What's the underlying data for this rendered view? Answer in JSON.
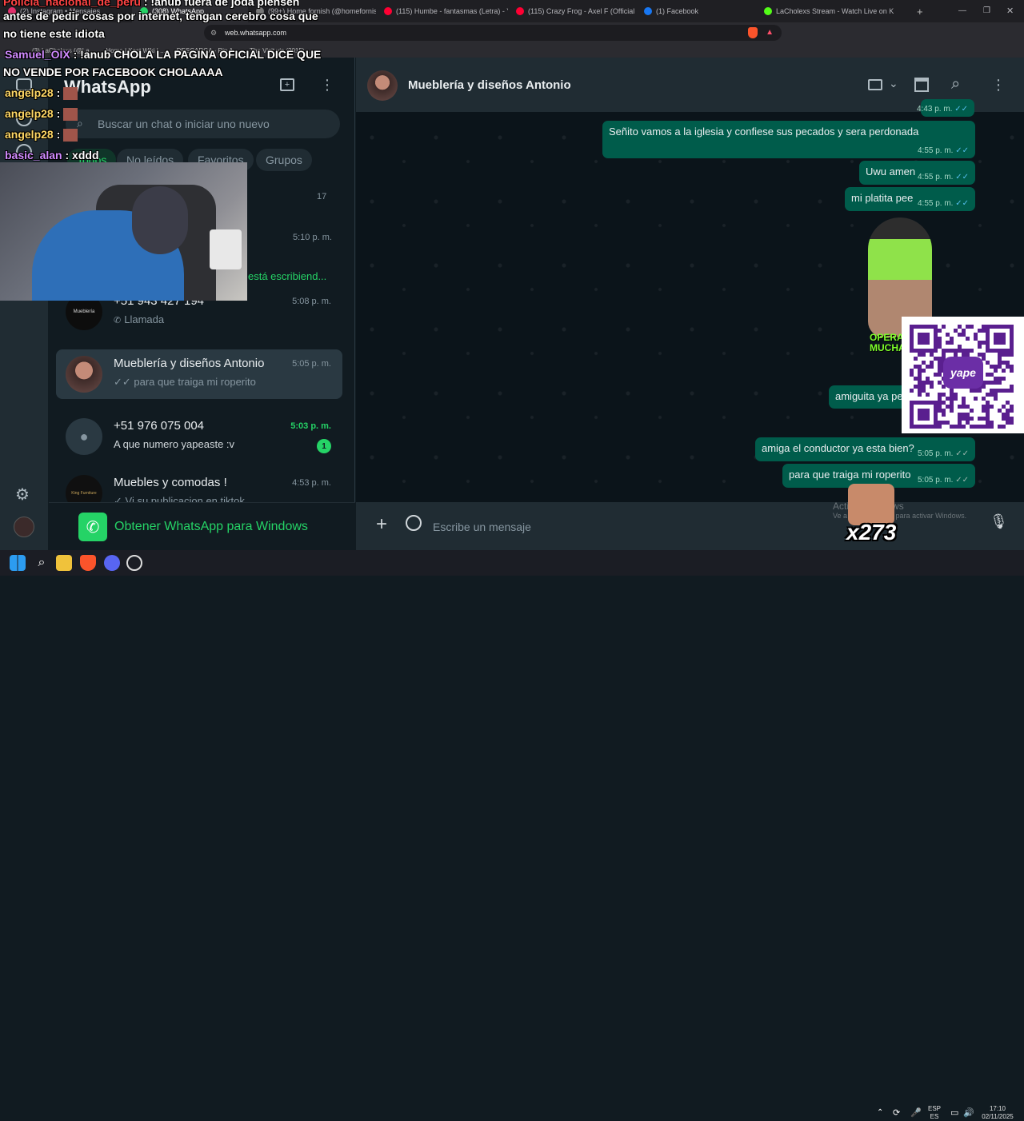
{
  "browser": {
    "tabs": [
      {
        "label": "(2) Instagram • Mensajes",
        "color": "#e1306c"
      },
      {
        "label": "(308) WhatsApp",
        "color": "#25d366"
      },
      {
        "label": "(99+) Home fornish (@homefornish)",
        "color": "#777"
      },
      {
        "label": "(115) Humbe - fantasmas (Letra) - Yo",
        "color": "#ff0033"
      },
      {
        "label": "(115) Crazy Frog - Axel F (Official Vid",
        "color": "#ff0033"
      },
      {
        "label": "(1) Facebook",
        "color": "#1877f2"
      },
      {
        "label": "LaCholexs Stream - Watch Live on K",
        "color": "#53fc18"
      }
    ],
    "url": "web.whatsapp.com",
    "bookmarks": [
      "(3) LaCholexs (@La...",
      "Home | Kast Wiki | ...",
      "DESCARGA - Rip A...",
      "The Visit vis (2015)..."
    ]
  },
  "whatsapp": {
    "title": "WhatsApp",
    "search_placeholder": "Buscar un chat o iniciar uno nuevo",
    "filters": [
      "Todos",
      "No leídos",
      "Favoritos",
      "Grupos"
    ],
    "partial_items": [
      {
        "time": "17"
      },
      {
        "time": "5:10 p. m.",
        "typing": "está escribiend..."
      }
    ],
    "chats": [
      {
        "name": "+51 943 427 194",
        "sub": "Llamada",
        "time": "5:08 p. m.",
        "avatar_text": "Mueblería",
        "avatar_color": "#0d0d0d"
      },
      {
        "name": "Mueblería y diseños Antonio",
        "sub": "✓✓ para que traiga mi roperito",
        "time": "5:05 p. m.",
        "avatar_text": "",
        "avatar_color": "#7a5a55"
      },
      {
        "name": "+51 976 075 004",
        "sub": "A que numero yapeaste :v",
        "time": "5:03 p. m.",
        "unread": "1",
        "avatar_text": "",
        "avatar_color": "#2a3942"
      },
      {
        "name": "Muebles y comodas !",
        "sub": "✓ Vi su publicacion en tiktok",
        "time": "4:53 p. m.",
        "avatar_text": "King Furniture",
        "avatar_color": "#101010"
      }
    ],
    "get_windows": "Obtener WhatsApp para Windows",
    "chat_header_name": "Mueblería y diseños Antonio",
    "messages": [
      {
        "text": "",
        "time": "4:43 p. m."
      },
      {
        "text": "Señito vamos a la iglesia y confiese sus pecados y sera perdonada",
        "time": "4:55 p. m."
      },
      {
        "text": "Uwu amen",
        "time": "4:55 p. m."
      },
      {
        "text": "mi platita pee",
        "time": "4:55 p. m."
      },
      {
        "text": "amiguita ya pe",
        "time": ""
      },
      {
        "text": "amiga el conductor ya esta bien?",
        "time": "5:05 p. m."
      },
      {
        "text": "para que traiga mi roperito",
        "time": "5:05 p. m."
      }
    ],
    "sticker_text": [
      "OPERA",
      "MUCHAC"
    ],
    "composer_placeholder": "Escribe un mensaje",
    "activate_windows": [
      "Activar Windows",
      "Ve a Configuración para activar Windows."
    ]
  },
  "overlay": {
    "chat_lines": [
      {
        "user": "Policia_nacional_de_peru",
        "msg": ": !anub fuera de joda piensen"
      },
      {
        "user": "",
        "msg": "antes de pedir cosas por internet, tengan cerebro cosa que"
      },
      {
        "user": "",
        "msg": "no tiene este idiota"
      },
      {
        "user": "Samuel_OIX",
        "msg": ": !anub CHOLA LA PAGINA OFICIAL DICE QUE"
      },
      {
        "user": "",
        "msg": "NO VENDE POR FACEBOOK CHOLAAAA"
      },
      {
        "user": "angelp28",
        "msg": ":"
      },
      {
        "user": "angelp28",
        "msg": ":"
      },
      {
        "user": "angelp28",
        "msg": ":"
      },
      {
        "user": "basic_alan",
        "msg": ": xddd"
      }
    ],
    "x_counter": "x273",
    "qr_label": "yape"
  },
  "taskbar": {
    "lang": [
      "ESP",
      "ES"
    ],
    "time": "17:10",
    "date": "02/11/2025"
  }
}
